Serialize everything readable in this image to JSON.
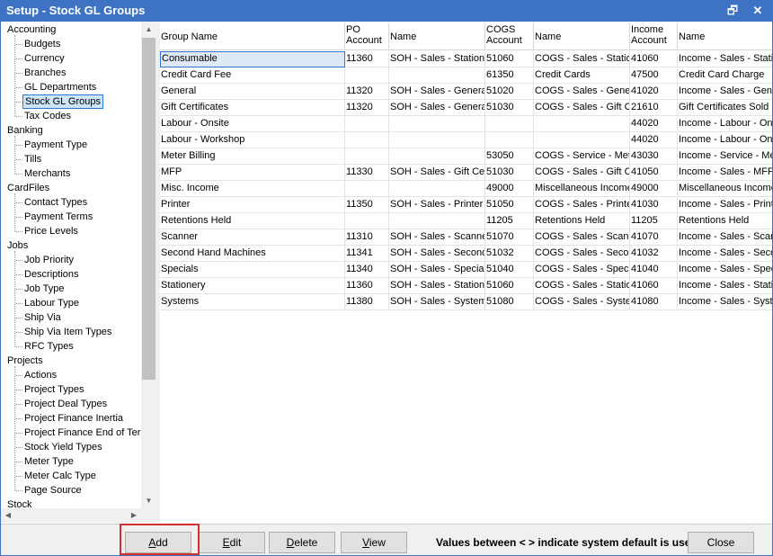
{
  "window": {
    "title": "Setup - Stock GL Groups",
    "restore_icon": "restore-icon",
    "close_icon": "close-icon"
  },
  "tree": {
    "categories": [
      {
        "label": "Accounting",
        "children": [
          "Budgets",
          "Currency",
          "Branches",
          "GL Departments",
          "Stock GL Groups",
          "Tax Codes"
        ]
      },
      {
        "label": "Banking",
        "children": [
          "Payment Type",
          "Tills",
          "Merchants"
        ]
      },
      {
        "label": "CardFiles",
        "children": [
          "Contact Types",
          "Payment Terms",
          "Price Levels"
        ]
      },
      {
        "label": "Jobs",
        "children": [
          "Job Priority",
          "Descriptions",
          "Job Type",
          "Labour Type",
          "Ship Via",
          "Ship Via Item Types",
          "RFC Types"
        ]
      },
      {
        "label": "Projects",
        "children": [
          "Actions",
          "Project Types",
          "Project Deal Types",
          "Project Finance Inertia",
          "Project Finance End of Term",
          "Stock Yield Types",
          "Meter Type",
          "Meter Calc Type",
          "Page Source"
        ]
      },
      {
        "label": "Stock",
        "children": []
      }
    ],
    "selected": "Stock GL Groups"
  },
  "grid": {
    "columns": [
      "Group Name",
      "PO\nAccount",
      "Name",
      "COGS\nAccount",
      "Name",
      "Income\nAccount",
      "Name"
    ],
    "rows": [
      [
        "Consumable",
        "11360",
        "SOH - Sales - Stationery",
        "51060",
        "COGS - Sales - Stationery",
        "41060",
        "Income - Sales - Stationery"
      ],
      [
        "Credit Card Fee",
        "",
        "",
        "61350",
        "Credit Cards",
        "47500",
        "Credit Card Charge"
      ],
      [
        "General",
        "11320",
        "SOH - Sales - General",
        "51020",
        "COGS - Sales - General",
        "41020",
        "Income - Sales - General"
      ],
      [
        "Gift Certificates",
        "11320",
        "SOH - Sales - General",
        "51030",
        "COGS - Sales - Gift Certificates",
        "21610",
        "Gift Certificates Sold"
      ],
      [
        "Labour - Onsite",
        "",
        "",
        "",
        "",
        "44020",
        "Income - Labour - Onsite"
      ],
      [
        "Labour - Workshop",
        "",
        "",
        "",
        "",
        "44020",
        "Income - Labour - Onsite"
      ],
      [
        "Meter Billing",
        "",
        "",
        "53050",
        "COGS - Service - Meter Billing",
        "43030",
        "Income - Service - Meter Billing"
      ],
      [
        "MFP",
        "11330",
        "SOH - Sales - Gift Certificates",
        "51030",
        "COGS - Sales - Gift Certificates",
        "41050",
        "Income - Sales - MFP"
      ],
      [
        "Misc. Income",
        "",
        "",
        "49000",
        "Miscellaneous Income",
        "49000",
        "Miscellaneous Income"
      ],
      [
        "Printer",
        "11350",
        "SOH - Sales - Printer",
        "51050",
        "COGS - Sales - Printer",
        "41030",
        "Income - Sales - Printer"
      ],
      [
        "Retentions Held",
        "",
        "",
        "11205",
        "Retentions Held",
        "11205",
        "Retentions Held"
      ],
      [
        "Scanner",
        "11310",
        "SOH - Sales - Scanner",
        "51070",
        "COGS - Sales - Scanner",
        "41070",
        "Income - Sales - Scanner"
      ],
      [
        "Second Hand Machines",
        "11341",
        "SOH - Sales - Second Hand",
        "51032",
        "COGS - Sales - Second Hand",
        "41032",
        "Income - Sales - Second Hand"
      ],
      [
        "Specials",
        "11340",
        "SOH - Sales - Specials",
        "51040",
        "COGS - Sales - Specials",
        "41040",
        "Income - Sales - Specials"
      ],
      [
        "Stationery",
        "11360",
        "SOH - Sales - Stationery",
        "51060",
        "COGS - Sales - Stationery",
        "41060",
        "Income - Sales - Stationery"
      ],
      [
        "Systems",
        "11380",
        "SOH - Sales - Systems",
        "51080",
        "COGS - Sales - Systems",
        "41080",
        "Income - Sales - Systems"
      ]
    ]
  },
  "buttons": {
    "add_first": "A",
    "add_rest": "dd",
    "edit_first": "E",
    "edit_rest": "dit",
    "delete_first": "D",
    "delete_rest": "elete",
    "view_first": "V",
    "view_rest": "iew",
    "close": "Close"
  },
  "info_text": "Values between < > indicate system default is used",
  "colors": {
    "titlebar": "#3e73c4",
    "selection": "#cce4f7",
    "highlight_box": "#d32f2f"
  }
}
